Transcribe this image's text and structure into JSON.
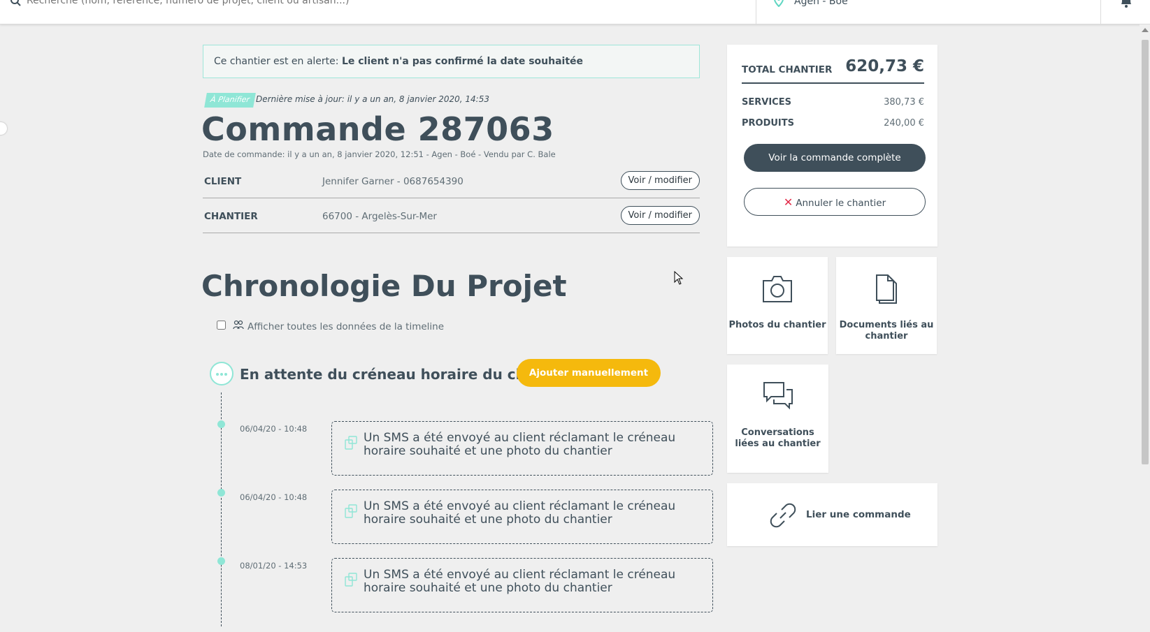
{
  "topbar": {
    "search_placeholder": "Recherche (nom, référence, numéro de projet, client ou artisan...)",
    "agency": "Agen - Boé"
  },
  "alert": {
    "prefix": "Ce chantier est en alerte: ",
    "message": "Le client n'a pas confirmé la date souhaitée"
  },
  "order": {
    "status": "À Planifier",
    "last_update": "Dernière mise à jour: il y a un an, 8 janvier 2020, 14:53",
    "title": "Commande 287063",
    "meta": "Date de commande: il y a un an, 8 janvier 2020, 12:51 - Agen - Boé - Vendu par C. Bale"
  },
  "info": {
    "client_label": "CLIENT",
    "client_value": "Jennifer Garner - 0687654390",
    "site_label": "CHANTIER",
    "site_value": "66700 - Argelès-Sur-Mer",
    "edit_label": "Voir / modifier"
  },
  "timeline": {
    "title": "Chronologie Du Projet",
    "show_all_label": "Afficher toutes les données de la timeline",
    "step_title": "En attente du créneau horaire du client",
    "add_button": "Ajouter manuellement",
    "events": [
      {
        "date": "06/04/20 - 10:48",
        "text": "Un SMS a été envoyé au client réclamant le créneau horaire souhaité et une photo du chantier"
      },
      {
        "date": "06/04/20 - 10:48",
        "text": "Un SMS a été envoyé au client réclamant le créneau horaire souhaité et une photo du chantier"
      },
      {
        "date": "08/01/20 - 14:53",
        "text": "Un SMS a été envoyé au client réclamant le créneau horaire souhaité et une photo du chantier"
      }
    ]
  },
  "summary": {
    "total_label": "TOTAL CHANTIER",
    "total_value": "620,73 €",
    "services_label": "SERVICES",
    "services_value": "380,73 €",
    "products_label": "PRODUITS",
    "products_value": "240,00 €",
    "view_order_button": "Voir la commande complète",
    "cancel_button": "Annuler le chantier"
  },
  "tiles": {
    "photos": "Photos du chantier",
    "documents": "Documents liés au chantier",
    "conversations": "Conversations liées au chantier",
    "link_order": "Lier une commande"
  },
  "colors": {
    "accent_teal": "#8fe6d6",
    "primary_dark": "#3f4f5a",
    "warning_yellow": "#f5b90d",
    "danger_red": "#e22a48"
  }
}
